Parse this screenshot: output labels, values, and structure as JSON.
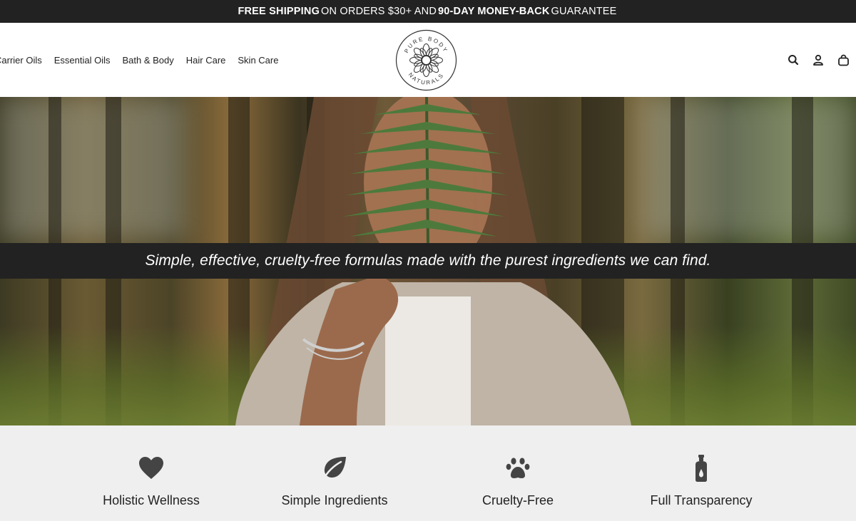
{
  "announcement": {
    "part1": "FREE SHIPPING",
    "part2": "ON ORDERS $30+ AND",
    "part3": "90-DAY MONEY-BACK",
    "part4": "GUARANTEE"
  },
  "nav": {
    "items": [
      {
        "label": "Carrier Oils"
      },
      {
        "label": "Essential Oils"
      },
      {
        "label": "Bath & Body"
      },
      {
        "label": "Hair Care"
      },
      {
        "label": "Skin Care"
      }
    ]
  },
  "logo": {
    "top_text": "PURE BODY",
    "bottom_text": "NATURALS"
  },
  "header_icons": [
    "search-icon",
    "account-icon",
    "cart-icon"
  ],
  "hero": {
    "tagline": "Simple, effective, cruelty-free formulas made with the purest ingredients we can find."
  },
  "features": [
    {
      "icon": "heart-icon",
      "label": "Holistic Wellness"
    },
    {
      "icon": "leaf-icon",
      "label": "Simple Ingredients"
    },
    {
      "icon": "paw-icon",
      "label": "Cruelty-Free"
    },
    {
      "icon": "bottle-icon",
      "label": "Full Transparency"
    }
  ],
  "colors": {
    "dark_bar": "#222222",
    "feature_bg": "#efefef",
    "icon": "#444444"
  }
}
